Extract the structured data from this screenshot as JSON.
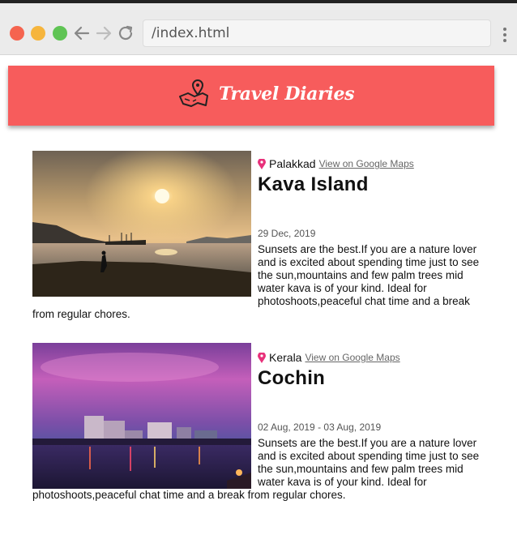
{
  "browser": {
    "url": "/index.html",
    "colors": {
      "close": "#f5644f",
      "minimize": "#f6b53d",
      "maximize": "#5fc454"
    }
  },
  "header": {
    "title": "Travel Diaries",
    "icon": "map-pin-icon",
    "color": "#f75c5c"
  },
  "posts": [
    {
      "location": "Palakkad",
      "map_link": "View on Google Maps",
      "place": "Kava Island",
      "date": "29 Dec, 2019",
      "description": "Sunsets are the best.If you are a nature lover and is excited about spending time just to see the sun,mountains and few palm trees mid water kava is of your kind. Ideal for photoshoots,peaceful chat time and a break from regular chores."
    },
    {
      "location": "Kerala",
      "map_link": "View on Google Maps",
      "place": "Cochin",
      "date": "02 Aug, 2019 - 03 Aug, 2019",
      "description": "Sunsets are the best.If you are a nature lover and is excited about spending time just to see the sun,mountains and few palm trees mid water kava is of your kind. Ideal for photoshoots,peaceful chat time and a break from regular chores."
    }
  ]
}
